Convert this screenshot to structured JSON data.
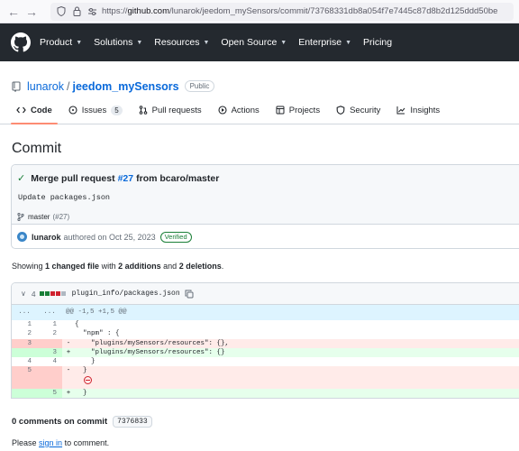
{
  "browser": {
    "url_prefix": "https://",
    "url_host": "github.com",
    "url_path": "/lunarok/jeedom_mySensors/commit/73768331db8a054f7e7445c87d8b2d125ddd50be"
  },
  "header": {
    "nav": [
      "Product",
      "Solutions",
      "Resources",
      "Open Source",
      "Enterprise",
      "Pricing"
    ]
  },
  "repo": {
    "owner": "lunarok",
    "separator": "/",
    "name": "jeedom_mySensors",
    "visibility": "Public"
  },
  "tabs": [
    {
      "label": "Code",
      "icon": "code-icon",
      "active": true
    },
    {
      "label": "Issues",
      "icon": "issues-icon",
      "count": "5"
    },
    {
      "label": "Pull requests",
      "icon": "pull-request-icon"
    },
    {
      "label": "Actions",
      "icon": "actions-icon"
    },
    {
      "label": "Projects",
      "icon": "projects-icon"
    },
    {
      "label": "Security",
      "icon": "shield-icon"
    },
    {
      "label": "Insights",
      "icon": "graph-icon"
    }
  ],
  "commit": {
    "heading": "Commit",
    "msg_prefix": "Merge pull request",
    "pr_link": "#27",
    "msg_suffix": "from bcaro/master",
    "description": "Update packages.json",
    "branch": "master",
    "branch_pr": "(#27)",
    "author": "lunarok",
    "authored_text": "authored on Oct 25, 2023",
    "verified": "Verified",
    "sha_short": "7376833"
  },
  "summary": {
    "showing": "Showing",
    "files": "1 changed file",
    "with": "with",
    "additions": "2 additions",
    "and": "and",
    "deletions": "2 deletions",
    "period": "."
  },
  "diff": {
    "count": "4",
    "diffstat_colors": [
      "#1a7f37",
      "#1a7f37",
      "#cf222e",
      "#cf222e",
      "#afb8c1"
    ],
    "filename": "plugin_info/packages.json",
    "hunk_left": "...",
    "hunk_right": "...",
    "hunk": "@@ -1,5 +1,5 @@",
    "lines": [
      {
        "type": "ctx",
        "old": "1",
        "new": "1",
        "sign": "",
        "code": "{"
      },
      {
        "type": "ctx",
        "old": "2",
        "new": "2",
        "sign": "",
        "code": "  \"npm\" : {"
      },
      {
        "type": "del",
        "old": "3",
        "new": "",
        "sign": "-",
        "code": "    \"plugins/mySensors/resources\": {},"
      },
      {
        "type": "add",
        "old": "",
        "new": "3",
        "sign": "+",
        "code": "    \"plugins/mySensors/resources\": {}"
      },
      {
        "type": "ctx",
        "old": "4",
        "new": "4",
        "sign": "",
        "code": "    }"
      },
      {
        "type": "del",
        "old": "5",
        "new": "",
        "sign": "-",
        "code": "  }"
      },
      {
        "type": "del-noeol",
        "old": "",
        "new": "",
        "sign": "",
        "code": ""
      },
      {
        "type": "add",
        "old": "",
        "new": "5",
        "sign": "+",
        "code": "  }"
      }
    ]
  },
  "comments": {
    "title": "0 comments on commit",
    "please": "Please",
    "sign_in": "sign in",
    "to_comment": "to comment."
  }
}
